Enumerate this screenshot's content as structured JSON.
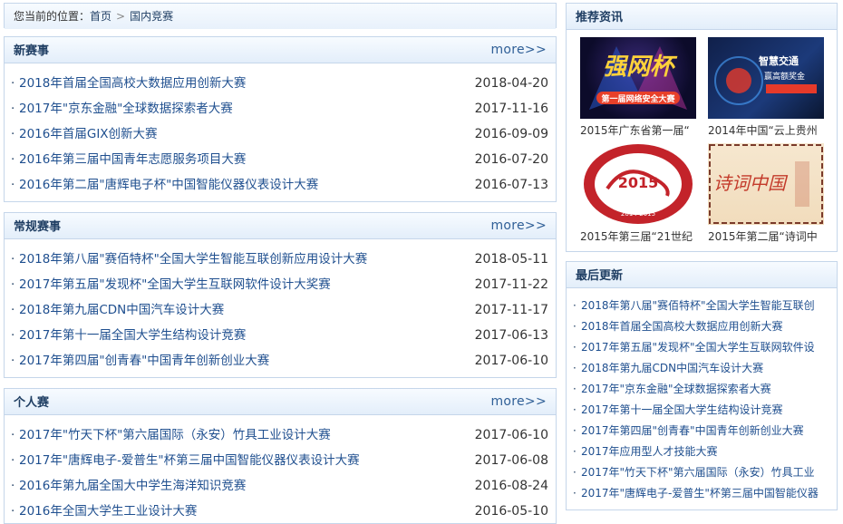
{
  "breadcrumb": {
    "prefix": "您当前的位置：",
    "home": "首页",
    "sep": ">",
    "current": "国内竞赛"
  },
  "sections": [
    {
      "title": "新赛事",
      "more": "more>>",
      "items": [
        {
          "title": "2018年首届全国高校大数据应用创新大赛",
          "date": "2018-04-20"
        },
        {
          "title": "2017年\"京东金融\"全球数据探索者大赛",
          "date": "2017-11-16"
        },
        {
          "title": "2016年首届GIX创新大赛",
          "date": "2016-09-09"
        },
        {
          "title": "2016年第三届中国青年志愿服务项目大赛",
          "date": "2016-07-20"
        },
        {
          "title": "2016年第二届\"唐辉电子杯\"中国智能仪器仪表设计大赛",
          "date": "2016-07-13"
        }
      ]
    },
    {
      "title": "常规赛事",
      "more": "more>>",
      "items": [
        {
          "title": "2018年第八届\"赛佰特杯\"全国大学生智能互联创新应用设计大赛",
          "date": "2018-05-11"
        },
        {
          "title": "2017年第五届\"发现杯\"全国大学生互联网软件设计大奖赛",
          "date": "2017-11-22"
        },
        {
          "title": "2018年第九届CDN中国汽车设计大赛",
          "date": "2017-11-17"
        },
        {
          "title": "2017年第十一届全国大学生结构设计竞赛",
          "date": "2017-06-13"
        },
        {
          "title": "2017年第四届\"创青春\"中国青年创新创业大赛",
          "date": "2017-06-10"
        }
      ]
    },
    {
      "title": "个人赛",
      "more": "more>>",
      "items": [
        {
          "title": "2017年\"竹天下杯\"第六届国际（永安）竹具工业设计大赛",
          "date": "2017-06-10"
        },
        {
          "title": "2017年\"唐辉电子-爱普生\"杯第三届中国智能仪器仪表设计大赛",
          "date": "2017-06-08"
        },
        {
          "title": "2016年第九届全国大中学生海洋知识竞赛",
          "date": "2016-08-24"
        },
        {
          "title": "2016年全国大学生工业设计大赛",
          "date": "2016-05-10"
        }
      ]
    }
  ],
  "recommend": {
    "title": "推荐资讯",
    "items": [
      {
        "caption": "2015年广东省第一届“",
        "img_text": "强网杯",
        "img_sub": "第一届网络安全大赛"
      },
      {
        "caption": "2014年中国“云上贵州",
        "img_text": "智慧交通",
        "img_sub": "赢高额奖金"
      },
      {
        "caption": "2015年第三届“21世纪",
        "img_text": "2015",
        "img_sub": "2014-2015"
      },
      {
        "caption": "2015年第二届“诗词中",
        "img_text": "诗词中国",
        "img_sub": ""
      }
    ]
  },
  "updates": {
    "title": "最后更新",
    "items": [
      "2018年第八届\"赛佰特杯\"全国大学生智能互联创",
      "2018年首届全国高校大数据应用创新大赛",
      "2017年第五届\"发现杯\"全国大学生互联网软件设",
      "2018年第九届CDN中国汽车设计大赛",
      "2017年\"京东金融\"全球数据探索者大赛",
      "2017年第十一届全国大学生结构设计竞赛",
      "2017年第四届\"创青春\"中国青年创新创业大赛",
      "2017年应用型人才技能大赛",
      "2017年\"竹天下杯\"第六届国际（永安）竹具工业",
      "2017年\"唐辉电子-爱普生\"杯第三届中国智能仪器"
    ]
  }
}
